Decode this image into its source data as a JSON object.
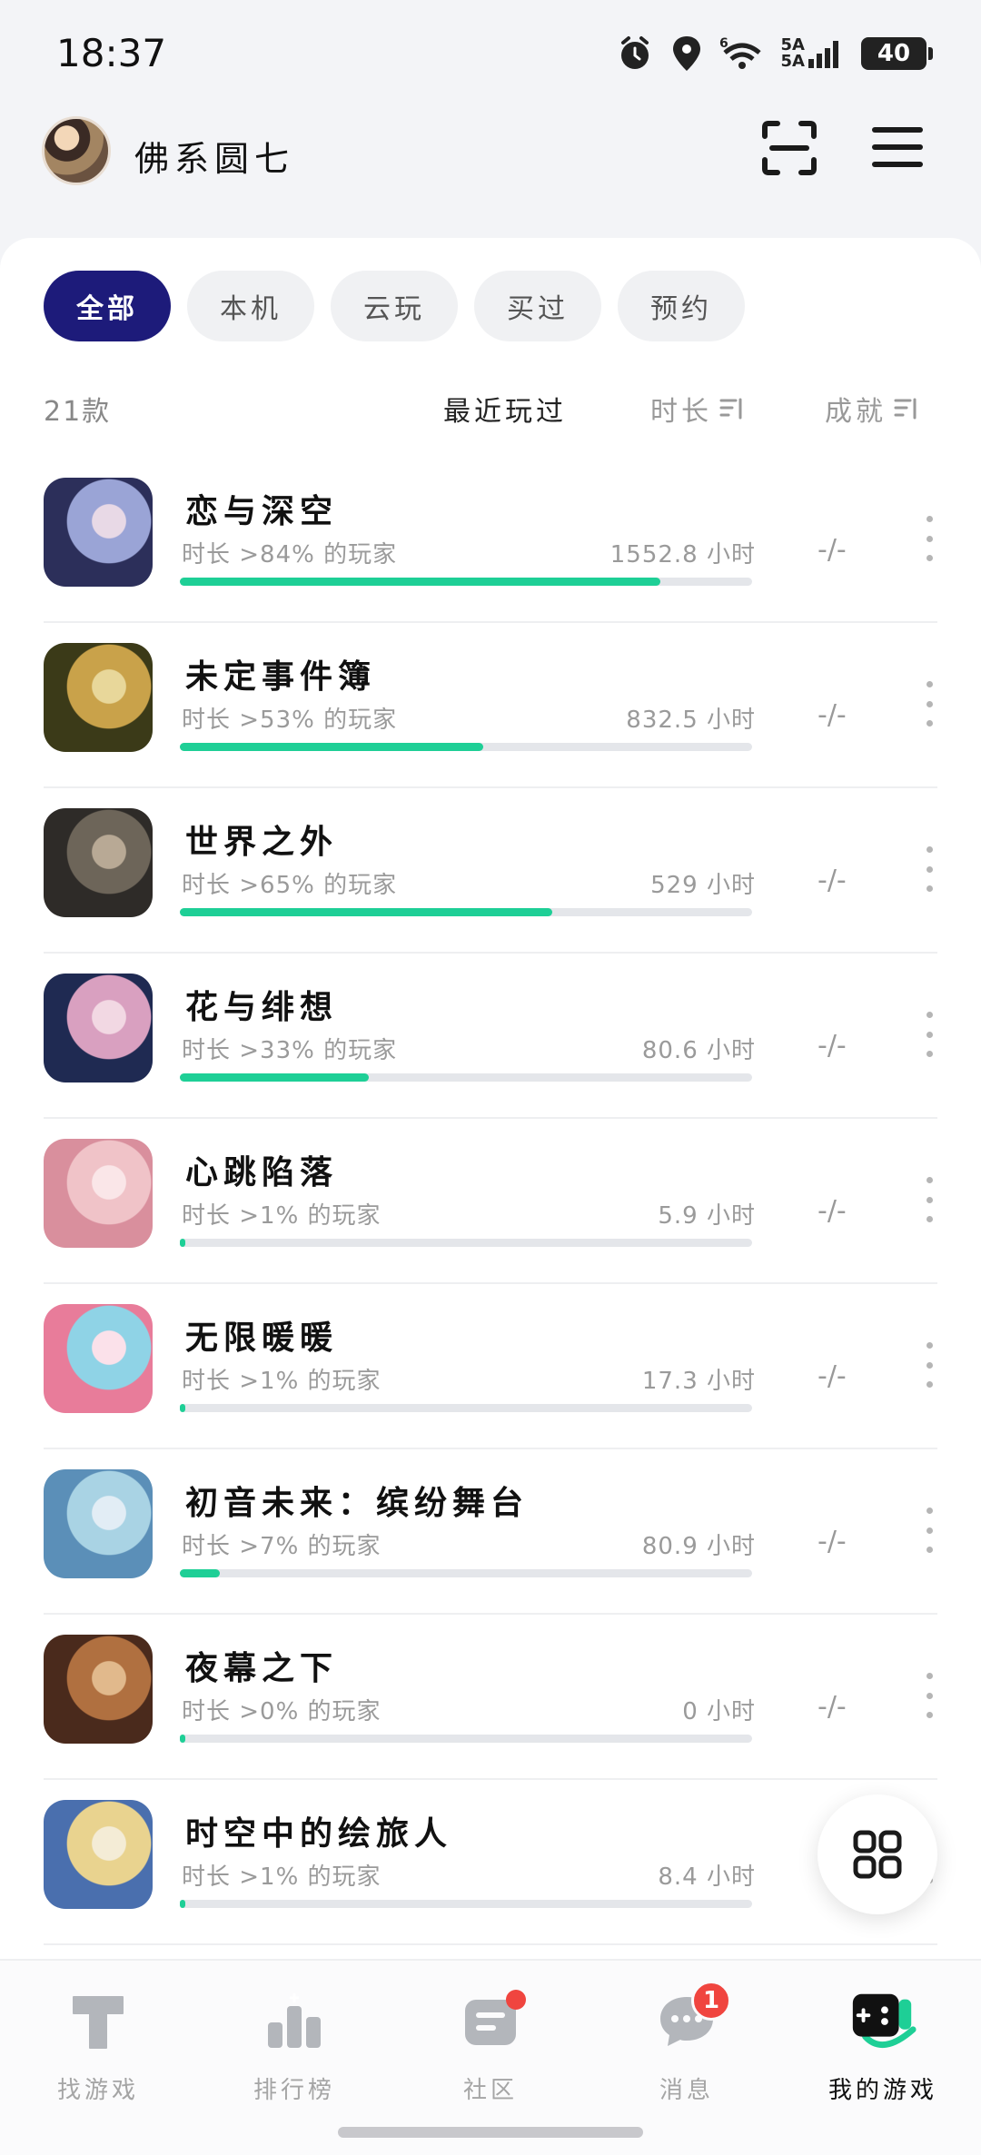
{
  "status_bar": {
    "time": "18:37",
    "network_top": "5A",
    "network_bottom": "5A",
    "signal_label": "6",
    "battery": "40"
  },
  "header": {
    "username": "佛系圆七"
  },
  "filters": [
    {
      "label": "全部",
      "active": true
    },
    {
      "label": "本机",
      "active": false
    },
    {
      "label": "云玩",
      "active": false
    },
    {
      "label": "买过",
      "active": false
    },
    {
      "label": "预约",
      "active": false
    }
  ],
  "list_header": {
    "count": "21款",
    "sort_recent": "最近玩过",
    "sort_duration": "时长",
    "sort_achievement": "成就"
  },
  "games": [
    {
      "name": "恋与深空",
      "stat": "时长 >84% 的玩家",
      "hours": "1552.8 小时",
      "achievement": "-/-",
      "progress": 0.84,
      "colors": [
        "#2c2f5a",
        "#9aa4d6",
        "#e8d9e6"
      ]
    },
    {
      "name": "未定事件簿",
      "stat": "时长 >53% 的玩家",
      "hours": "832.5 小时",
      "achievement": "-/-",
      "progress": 0.53,
      "colors": [
        "#3b3a18",
        "#c9a24a",
        "#e8d79a"
      ]
    },
    {
      "name": "世界之外",
      "stat": "时长 >65% 的玩家",
      "hours": "529 小时",
      "achievement": "-/-",
      "progress": 0.65,
      "colors": [
        "#2e2b28",
        "#6d6559",
        "#b8a995"
      ]
    },
    {
      "name": "花与绯想",
      "stat": "时长 >33% 的玩家",
      "hours": "80.6 小时",
      "achievement": "-/-",
      "progress": 0.33,
      "colors": [
        "#1f2a52",
        "#d9a0c0",
        "#f2d8e3"
      ]
    },
    {
      "name": "心跳陷落",
      "stat": "时长 >1% 的玩家",
      "hours": "5.9 小时",
      "achievement": "-/-",
      "progress": 0.01,
      "colors": [
        "#d98f9d",
        "#f0c3c8",
        "#fae6e8"
      ]
    },
    {
      "name": "无限暖暖",
      "stat": "时长 >1% 的玩家",
      "hours": "17.3 小时",
      "achievement": "-/-",
      "progress": 0.01,
      "colors": [
        "#e87c9a",
        "#8fd3e6",
        "#fbe1ea"
      ]
    },
    {
      "name": "初音未来：缤纷舞台",
      "stat": "时长 >7% 的玩家",
      "hours": "80.9 小时",
      "achievement": "-/-",
      "progress": 0.07,
      "colors": [
        "#5b8fb8",
        "#a9d3e4",
        "#e2edf5"
      ]
    },
    {
      "name": "夜幕之下",
      "stat": "时长 >0% 的玩家",
      "hours": "0 小时",
      "achievement": "-/-",
      "progress": 0.0,
      "colors": [
        "#4a2a1c",
        "#b07040",
        "#e1b98c"
      ]
    },
    {
      "name": "时空中的绘旅人",
      "stat": "时长 >1% 的玩家",
      "hours": "8.4 小时",
      "achievement": "",
      "progress": 0.01,
      "colors": [
        "#4a6fae",
        "#e9d38f",
        "#f4ecd6"
      ]
    }
  ],
  "bottom_nav": [
    {
      "label": "找游戏",
      "icon": "find-game-icon",
      "active": false
    },
    {
      "label": "排行榜",
      "icon": "leaderboard-icon",
      "active": false
    },
    {
      "label": "社区",
      "icon": "community-icon",
      "active": false,
      "dot": true
    },
    {
      "label": "消息",
      "icon": "message-icon",
      "active": false,
      "badge": "1"
    },
    {
      "label": "我的游戏",
      "icon": "gamepad-icon",
      "active": true
    }
  ],
  "colors": {
    "accent": "#1d1b7a",
    "progress": "#1ecf96",
    "badge": "#f0453f"
  }
}
